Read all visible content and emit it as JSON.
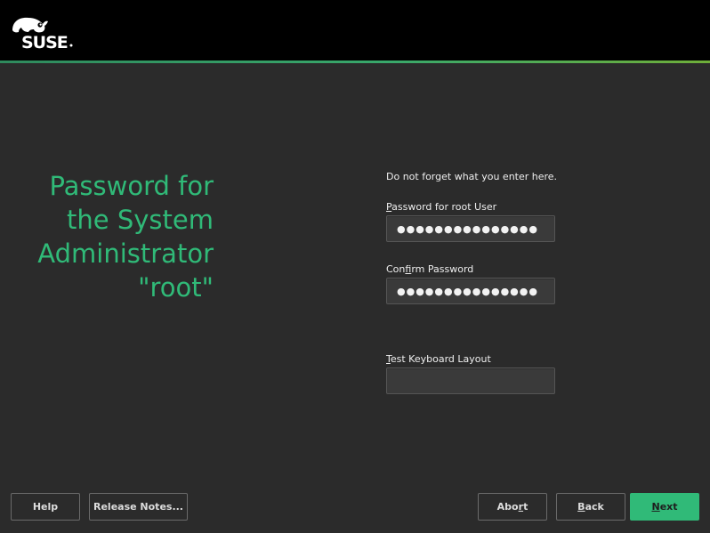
{
  "header": {
    "brand": "SUSE",
    "accent_color": "#30ba78"
  },
  "page": {
    "title": "Password for\nthe System\nAdministrator\n\"root\"",
    "hint": "Do not forget what you enter here."
  },
  "form": {
    "password_label_mnemonic": "P",
    "password_label_rest": "assword for root User",
    "password_value": "●●●●●●●●●●●●●●●",
    "confirm_label_pre": "Con",
    "confirm_label_mnemonic": "f",
    "confirm_label_post": "irm Password",
    "confirm_value": "●●●●●●●●●●●●●●●",
    "keyboard_label_mnemonic": "T",
    "keyboard_label_rest": "est Keyboard Layout",
    "keyboard_value": ""
  },
  "buttons": {
    "help": "Help",
    "release_notes": "Release Notes...",
    "abort_pre": "Abo",
    "abort_mnemonic": "r",
    "abort_post": "t",
    "back_mnemonic": "B",
    "back_rest": "ack",
    "next_mnemonic": "N",
    "next_rest": "ext"
  }
}
